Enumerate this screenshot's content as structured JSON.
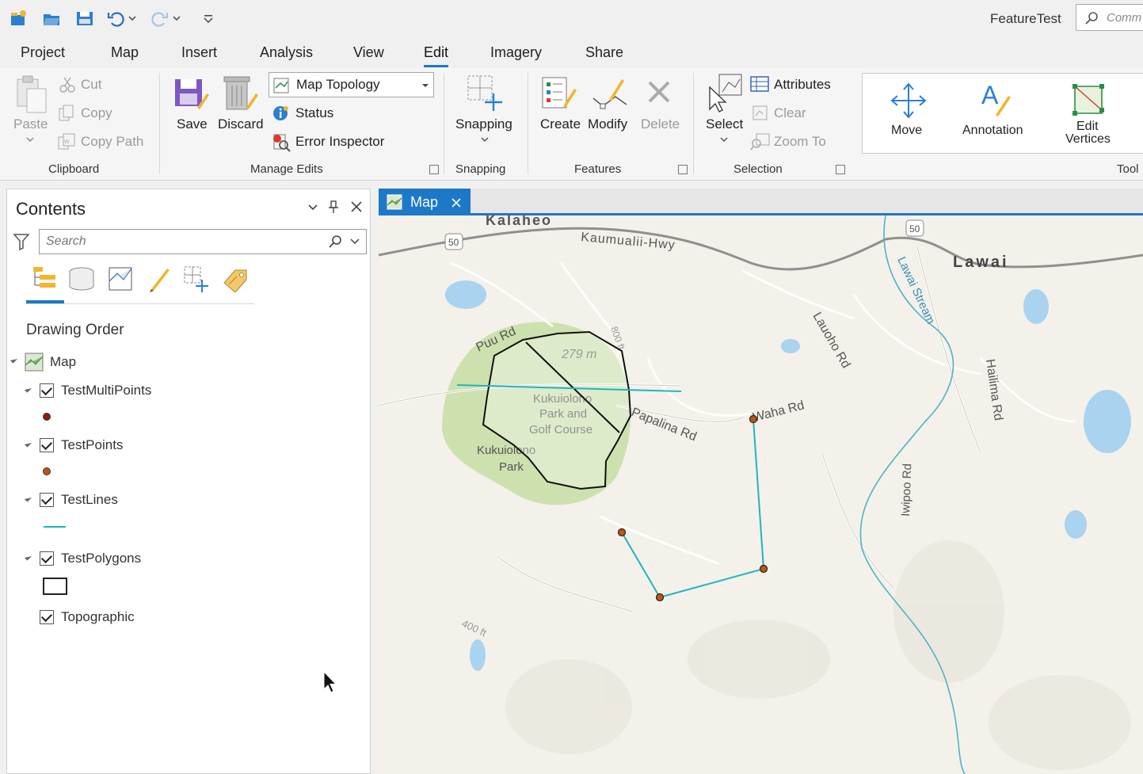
{
  "app": {
    "project_title": "FeatureTest",
    "command_search_placeholder": "Comm"
  },
  "ribbon_tabs": [
    {
      "label": "Project"
    },
    {
      "label": "Map"
    },
    {
      "label": "Insert"
    },
    {
      "label": "Analysis"
    },
    {
      "label": "View"
    },
    {
      "label": "Edit",
      "active": true
    },
    {
      "label": "Imagery"
    },
    {
      "label": "Share"
    }
  ],
  "ribbon": {
    "clipboard": {
      "paste": "Paste",
      "cut": "Cut",
      "copy": "Copy",
      "copy_path": "Copy Path",
      "group": "Clipboard"
    },
    "manage_edits": {
      "save": "Save",
      "discard": "Discard",
      "topology_select": "Map Topology",
      "status": "Status",
      "error_inspector": "Error Inspector",
      "group": "Manage Edits"
    },
    "snapping": {
      "snapping": "Snapping",
      "group": "Snapping"
    },
    "features": {
      "create": "Create",
      "modify": "Modify",
      "delete": "Delete",
      "group": "Features"
    },
    "selection": {
      "select": "Select",
      "attributes": "Attributes",
      "clear": "Clear",
      "zoom_to": "Zoom To",
      "group": "Selection"
    },
    "tools": {
      "move": "Move",
      "annotation": "Annotation",
      "edit_vertices_line1": "Edit",
      "edit_vertices_line2": "Vertices",
      "group": "Tool"
    }
  },
  "contents": {
    "title": "Contents",
    "search_placeholder": "Search",
    "drawing_order": "Drawing Order",
    "map_label": "Map",
    "layers": [
      {
        "name": "TestMultiPoints",
        "checked": true
      },
      {
        "name": "TestPoints",
        "checked": true
      },
      {
        "name": "TestLines",
        "checked": true
      },
      {
        "name": "TestPolygons",
        "checked": true
      },
      {
        "name": "Topographic",
        "checked": true
      }
    ]
  },
  "map_tab": {
    "label": "Map"
  },
  "map_labels": {
    "kalaheo": "Kalaheo",
    "hwy": "Kaumualii-Hwy",
    "route50a": "50",
    "route50b": "50",
    "lawai": "Lawai",
    "lawai_stream": "Lawai Stream",
    "puu_rd": "Puu Rd",
    "distance": "279 m",
    "elev800": "800 ft",
    "park1": "Kukuiolono",
    "park2": "Park and",
    "park3": "Golf Course",
    "park4": "Kukuiolono",
    "park5": "Park",
    "papalina": "Papalina Rd",
    "waha": "Waha Rd",
    "lauoho": "Lauoho Rd",
    "hailima": "Hailima Rd",
    "iwipoo": "Iwipoo Rd",
    "elev400": "400 ft"
  },
  "colors": {
    "accent": "#1e78c8",
    "line_feature": "#1fb5c0",
    "point_feature": "#c0360f",
    "park_green": "#c9dfa7"
  }
}
